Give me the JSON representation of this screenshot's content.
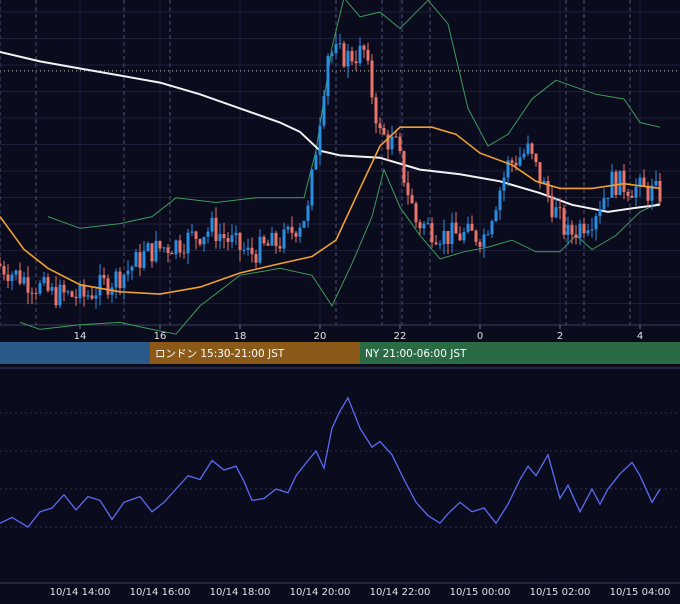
{
  "colors": {
    "background": "#0b0b1e",
    "grid": "#1c1f3a",
    "vline": "#4a5070",
    "candle_up": "#2a8de0",
    "candle_down": "#e8756a",
    "bollinger": "#3f9a5a",
    "ma_short": "#f0a030",
    "ma_long": "#f2f2f2",
    "oscillator": "#5a6cf0",
    "axis_text": "#e0e0e0",
    "session_tokyo": "#2b5a8a",
    "session_london": "#8c5a18",
    "session_ny": "#2a6b45",
    "session_text": "#ffffff"
  },
  "sessions": [
    {
      "name": "tokyo",
      "label": "",
      "start_hour": 12.0,
      "end_hour": 15.75
    },
    {
      "name": "london",
      "label": "ロンドン 15:30-21:00 JST",
      "start_hour": 15.75,
      "end_hour": 21.0
    },
    {
      "name": "ny",
      "label": "NY 21:00-06:00 JST",
      "start_hour": 21.0,
      "end_hour": 28.5
    }
  ],
  "chart_data": [
    {
      "type": "line",
      "subtype": "candlestick",
      "x_range": [
        12.0,
        28.5
      ],
      "y_range": [
        -0.34,
        1.0
      ],
      "x_ticks": [
        {
          "x": 14,
          "label": "14"
        },
        {
          "x": 16,
          "label": "16"
        },
        {
          "x": 18,
          "label": "18"
        },
        {
          "x": 20,
          "label": "20"
        },
        {
          "x": 22,
          "label": "22"
        },
        {
          "x": 24,
          "label": "0"
        },
        {
          "x": 26,
          "label": "2"
        },
        {
          "x": 28,
          "label": "4"
        }
      ],
      "reference_line": 0.72,
      "event_lines": [
        12.0,
        12.9,
        15.1,
        16.25,
        20.4,
        21.55,
        22.05,
        22.75,
        26.15,
        26.6,
        27.75
      ],
      "series": [
        {
          "kind": "candles",
          "value_points": [
            [
              12.0,
              -0.1
            ],
            [
              13.4,
              -0.23
            ],
            [
              14.2,
              -0.24
            ],
            [
              15.2,
              -0.14
            ],
            [
              15.8,
              -0.05
            ],
            [
              16.6,
              -0.01
            ],
            [
              17.4,
              0.05
            ],
            [
              18.3,
              -0.06
            ],
            [
              19.2,
              0.0
            ],
            [
              19.8,
              0.12
            ],
            [
              20.3,
              0.8
            ],
            [
              20.8,
              0.78
            ],
            [
              21.2,
              0.8
            ],
            [
              21.6,
              0.45
            ],
            [
              22.0,
              0.4
            ],
            [
              22.5,
              0.08
            ],
            [
              23.2,
              0.02
            ],
            [
              23.8,
              0.02
            ],
            [
              24.2,
              0.02
            ],
            [
              24.8,
              0.32
            ],
            [
              25.3,
              0.38
            ],
            [
              25.9,
              0.15
            ],
            [
              26.3,
              0.02
            ],
            [
              26.9,
              0.1
            ],
            [
              27.4,
              0.25
            ],
            [
              28.0,
              0.22
            ],
            [
              28.5,
              0.2
            ]
          ]
        },
        {
          "kind": "ma_short",
          "points": [
            [
              12.0,
              0.1
            ],
            [
              12.6,
              -0.04
            ],
            [
              13.2,
              -0.12
            ],
            [
              14.0,
              -0.19
            ],
            [
              15.0,
              -0.22
            ],
            [
              16.0,
              -0.23
            ],
            [
              17.0,
              -0.2
            ],
            [
              18.0,
              -0.14
            ],
            [
              19.0,
              -0.1
            ],
            [
              19.8,
              -0.07
            ],
            [
              20.4,
              0.0
            ],
            [
              21.0,
              0.22
            ],
            [
              21.5,
              0.4
            ],
            [
              22.0,
              0.48
            ],
            [
              22.8,
              0.48
            ],
            [
              23.4,
              0.45
            ],
            [
              24.0,
              0.37
            ],
            [
              24.8,
              0.32
            ],
            [
              25.4,
              0.25
            ],
            [
              26.0,
              0.22
            ],
            [
              26.8,
              0.22
            ],
            [
              27.6,
              0.24
            ],
            [
              28.5,
              0.22
            ]
          ]
        },
        {
          "kind": "ma_long",
          "points": [
            [
              12.0,
              0.8
            ],
            [
              13.0,
              0.76
            ],
            [
              14.0,
              0.73
            ],
            [
              15.0,
              0.7
            ],
            [
              16.0,
              0.67
            ],
            [
              17.0,
              0.62
            ],
            [
              18.0,
              0.56
            ],
            [
              19.0,
              0.5
            ],
            [
              19.5,
              0.46
            ],
            [
              20.0,
              0.38
            ],
            [
              20.5,
              0.36
            ],
            [
              21.5,
              0.35
            ],
            [
              22.5,
              0.3
            ],
            [
              23.5,
              0.28
            ],
            [
              24.5,
              0.25
            ],
            [
              25.5,
              0.2
            ],
            [
              26.3,
              0.15
            ],
            [
              27.2,
              0.12
            ],
            [
              28.0,
              0.14
            ],
            [
              28.5,
              0.15
            ]
          ]
        },
        {
          "kind": "bollinger_upper",
          "points": [
            [
              13.2,
              0.1
            ],
            [
              14.0,
              0.05
            ],
            [
              15.0,
              0.07
            ],
            [
              15.8,
              0.1
            ],
            [
              16.4,
              0.18
            ],
            [
              17.4,
              0.16
            ],
            [
              18.4,
              0.18
            ],
            [
              19.6,
              0.18
            ],
            [
              19.9,
              0.38
            ],
            [
              20.3,
              0.82
            ],
            [
              20.6,
              1.03
            ],
            [
              21.0,
              0.95
            ],
            [
              21.5,
              0.97
            ],
            [
              22.0,
              0.9
            ],
            [
              22.7,
              1.02
            ],
            [
              23.2,
              0.92
            ],
            [
              23.7,
              0.56
            ],
            [
              24.2,
              0.4
            ],
            [
              24.7,
              0.45
            ],
            [
              25.3,
              0.6
            ],
            [
              25.9,
              0.68
            ],
            [
              26.4,
              0.65
            ],
            [
              26.9,
              0.62
            ],
            [
              27.6,
              0.6
            ],
            [
              28.0,
              0.5
            ],
            [
              28.5,
              0.48
            ]
          ]
        },
        {
          "kind": "bollinger_lower",
          "points": [
            [
              12.5,
              -0.35
            ],
            [
              13.0,
              -0.38
            ],
            [
              14.0,
              -0.36
            ],
            [
              15.0,
              -0.35
            ],
            [
              15.8,
              -0.38
            ],
            [
              16.4,
              -0.4
            ],
            [
              17.0,
              -0.28
            ],
            [
              18.0,
              -0.15
            ],
            [
              19.0,
              -0.12
            ],
            [
              19.8,
              -0.15
            ],
            [
              20.3,
              -0.28
            ],
            [
              20.8,
              -0.1
            ],
            [
              21.3,
              0.1
            ],
            [
              21.6,
              0.3
            ],
            [
              22.0,
              0.14
            ],
            [
              22.5,
              0.02
            ],
            [
              23.0,
              -0.08
            ],
            [
              23.6,
              -0.05
            ],
            [
              24.2,
              -0.03
            ],
            [
              24.8,
              0.0
            ],
            [
              25.4,
              -0.05
            ],
            [
              26.0,
              -0.05
            ],
            [
              26.4,
              0.02
            ],
            [
              26.8,
              -0.04
            ],
            [
              27.4,
              0.02
            ],
            [
              28.0,
              0.12
            ],
            [
              28.5,
              0.16
            ]
          ]
        }
      ]
    },
    {
      "type": "line",
      "subtype": "oscillator",
      "x_range": [
        12.0,
        28.5
      ],
      "y_range": [
        0.0,
        1.0
      ],
      "x_ticks": [
        {
          "x": 14,
          "label": "10/14 14:00"
        },
        {
          "x": 16,
          "label": "10/14 16:00"
        },
        {
          "x": 18,
          "label": "10/14 18:00"
        },
        {
          "x": 20,
          "label": "10/14 20:00"
        },
        {
          "x": 22,
          "label": "10/14 22:00"
        },
        {
          "x": 24,
          "label": "10/15 00:00"
        },
        {
          "x": 26,
          "label": "10/15 02:00"
        },
        {
          "x": 28,
          "label": "10/15 04:00"
        }
      ],
      "grid_levels": [
        0.2,
        0.4,
        0.6,
        0.8
      ],
      "series": [
        {
          "name": "",
          "points": [
            [
              12.0,
              0.22
            ],
            [
              12.3,
              0.25
            ],
            [
              12.7,
              0.2
            ],
            [
              13.0,
              0.28
            ],
            [
              13.3,
              0.3
            ],
            [
              13.6,
              0.37
            ],
            [
              13.9,
              0.29
            ],
            [
              14.2,
              0.36
            ],
            [
              14.5,
              0.34
            ],
            [
              14.8,
              0.24
            ],
            [
              15.1,
              0.33
            ],
            [
              15.5,
              0.36
            ],
            [
              15.8,
              0.28
            ],
            [
              16.1,
              0.33
            ],
            [
              16.4,
              0.4
            ],
            [
              16.7,
              0.47
            ],
            [
              17.0,
              0.45
            ],
            [
              17.3,
              0.55
            ],
            [
              17.6,
              0.5
            ],
            [
              17.9,
              0.52
            ],
            [
              18.1,
              0.44
            ],
            [
              18.3,
              0.34
            ],
            [
              18.6,
              0.35
            ],
            [
              18.9,
              0.4
            ],
            [
              19.2,
              0.38
            ],
            [
              19.4,
              0.47
            ],
            [
              19.7,
              0.55
            ],
            [
              19.9,
              0.6
            ],
            [
              20.1,
              0.51
            ],
            [
              20.3,
              0.72
            ],
            [
              20.5,
              0.81
            ],
            [
              20.7,
              0.88
            ],
            [
              21.0,
              0.72
            ],
            [
              21.3,
              0.62
            ],
            [
              21.5,
              0.65
            ],
            [
              21.8,
              0.58
            ],
            [
              22.1,
              0.45
            ],
            [
              22.4,
              0.33
            ],
            [
              22.7,
              0.26
            ],
            [
              23.0,
              0.22
            ],
            [
              23.2,
              0.27
            ],
            [
              23.5,
              0.33
            ],
            [
              23.8,
              0.28
            ],
            [
              24.1,
              0.3
            ],
            [
              24.4,
              0.22
            ],
            [
              24.7,
              0.32
            ],
            [
              25.0,
              0.45
            ],
            [
              25.2,
              0.52
            ],
            [
              25.4,
              0.47
            ],
            [
              25.7,
              0.58
            ],
            [
              26.0,
              0.35
            ],
            [
              26.2,
              0.42
            ],
            [
              26.5,
              0.28
            ],
            [
              26.8,
              0.4
            ],
            [
              27.0,
              0.32
            ],
            [
              27.2,
              0.4
            ],
            [
              27.5,
              0.48
            ],
            [
              27.8,
              0.54
            ],
            [
              28.0,
              0.47
            ],
            [
              28.3,
              0.33
            ],
            [
              28.5,
              0.4
            ]
          ]
        }
      ]
    }
  ]
}
